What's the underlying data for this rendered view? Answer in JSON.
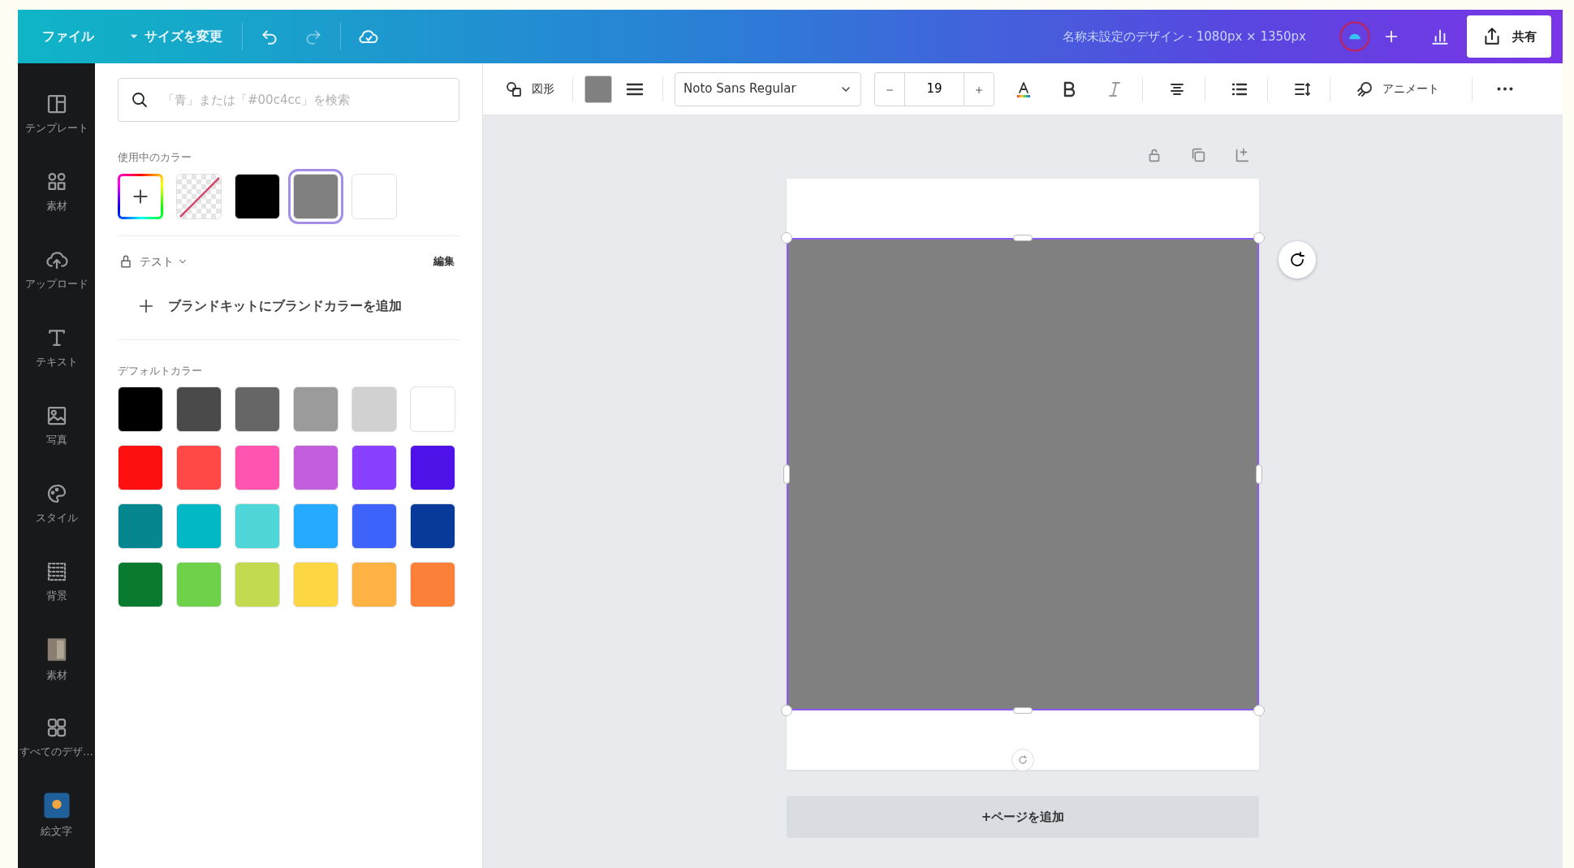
{
  "top_bar": {
    "file_menu": "ファイル",
    "resize": "サイズを変更",
    "title": "名称未設定のデザイン - 1080px × 1350px",
    "share": "共有"
  },
  "sidebar": {
    "items": [
      {
        "kind": "template",
        "label": "テンプレート"
      },
      {
        "kind": "elements",
        "label": "素材"
      },
      {
        "kind": "upload",
        "label": "アップロード"
      },
      {
        "kind": "text",
        "label": "テキスト"
      },
      {
        "kind": "photo",
        "label": "写真"
      },
      {
        "kind": "style",
        "label": "スタイル"
      },
      {
        "kind": "background",
        "label": "背景"
      },
      {
        "kind": "material",
        "label": "素材"
      },
      {
        "kind": "designs",
        "label": "すべてのデザ…"
      },
      {
        "kind": "emoji",
        "label": "絵文字"
      }
    ]
  },
  "color_panel": {
    "search": {
      "placeholder": "「青」または「#00c4cc」を検索"
    },
    "used_title": "使用中のカラー",
    "used_colors": [
      {
        "kind": "add",
        "selected": false
      },
      {
        "kind": "none",
        "selected": false
      },
      {
        "kind": "swatch",
        "color": "#000000",
        "selected": false
      },
      {
        "kind": "swatch",
        "color": "#808080",
        "selected": true
      },
      {
        "kind": "swatch",
        "color": "#ffffff",
        "selected": false
      }
    ],
    "brand": {
      "name": "テスト",
      "edit": "編集",
      "add": "ブランドキットにブランドカラーを追加"
    },
    "default_title": "デフォルトカラー",
    "default_colors": [
      {
        "color": "#000000"
      },
      {
        "color": "#4a4a4a"
      },
      {
        "color": "#666666"
      },
      {
        "color": "#9b9b9b"
      },
      {
        "color": "#d1d1d1"
      },
      {
        "color": "#ffffff"
      },
      {
        "color": "#ff1010"
      },
      {
        "color": "#ff4848"
      },
      {
        "color": "#ff55b0"
      },
      {
        "color": "#c35ede"
      },
      {
        "color": "#8a41ff"
      },
      {
        "color": "#4e12e8"
      },
      {
        "color": "#06878f"
      },
      {
        "color": "#02b8c5"
      },
      {
        "color": "#4fd6d9"
      },
      {
        "color": "#25aaff"
      },
      {
        "color": "#3e63fb"
      },
      {
        "color": "#083a9c"
      },
      {
        "color": "#0a7a2e"
      },
      {
        "color": "#6dd24a"
      },
      {
        "color": "#c2da50"
      },
      {
        "color": "#fdd743"
      },
      {
        "color": "#feb244"
      },
      {
        "color": "#fd8038"
      }
    ]
  },
  "toolbar": {
    "shape": "図形",
    "font": "Noto Sans Regular",
    "font_size": "19",
    "animate": "アニメート"
  },
  "canvas": {
    "add_page": "+ページを追加"
  }
}
